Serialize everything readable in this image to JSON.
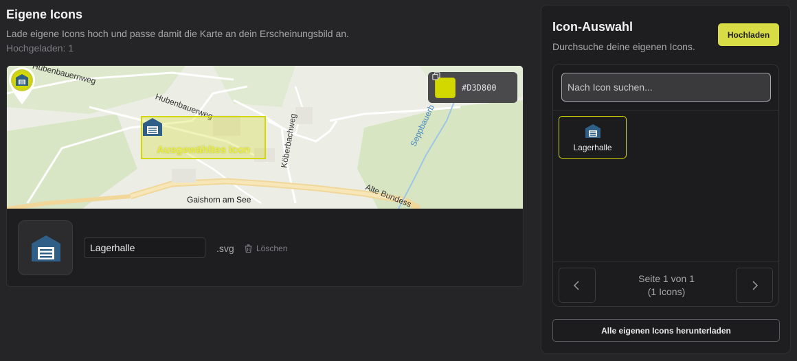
{
  "header": {
    "title": "Eigene Icons",
    "description": "Lade eigene Icons hoch und passe damit die Karte an dein Erscheinungsbild an.",
    "uploaded_count": "Hochgeladen: 1"
  },
  "map": {
    "labels": {
      "hubenbauernweg_1": "Hubenbauernweg",
      "hubenbauernweg_2": "Hubenbauerweg",
      "koeberbachweg": "Köberbachweg",
      "seppbauer": "Seppbauerb",
      "gaishorn": "Gaishorn am See",
      "alte_bundes": "Alte Bundess"
    },
    "selected_label": "Ausgewähltes Icon",
    "accent_color": "#D3D800",
    "color_hex": "#D3D800",
    "icon_color": "#2F5F86"
  },
  "editor": {
    "icon_name": "Lagerhalle",
    "extension": ".svg",
    "delete_label": "Löschen"
  },
  "sidebar": {
    "title": "Icon-Auswahl",
    "subtitle": "Durchsuche deine eigenen Icons.",
    "upload_label": "Hochladen",
    "search_placeholder": "Nach Icon suchen...",
    "icons": [
      {
        "label": "Lagerhalle",
        "icon": "warehouse-icon",
        "selected": true
      }
    ],
    "pagination": {
      "page_text": "Seite 1 von 1",
      "count_text": "(1 Icons)"
    },
    "download_label": "Alle eigenen Icons herunterladen"
  }
}
